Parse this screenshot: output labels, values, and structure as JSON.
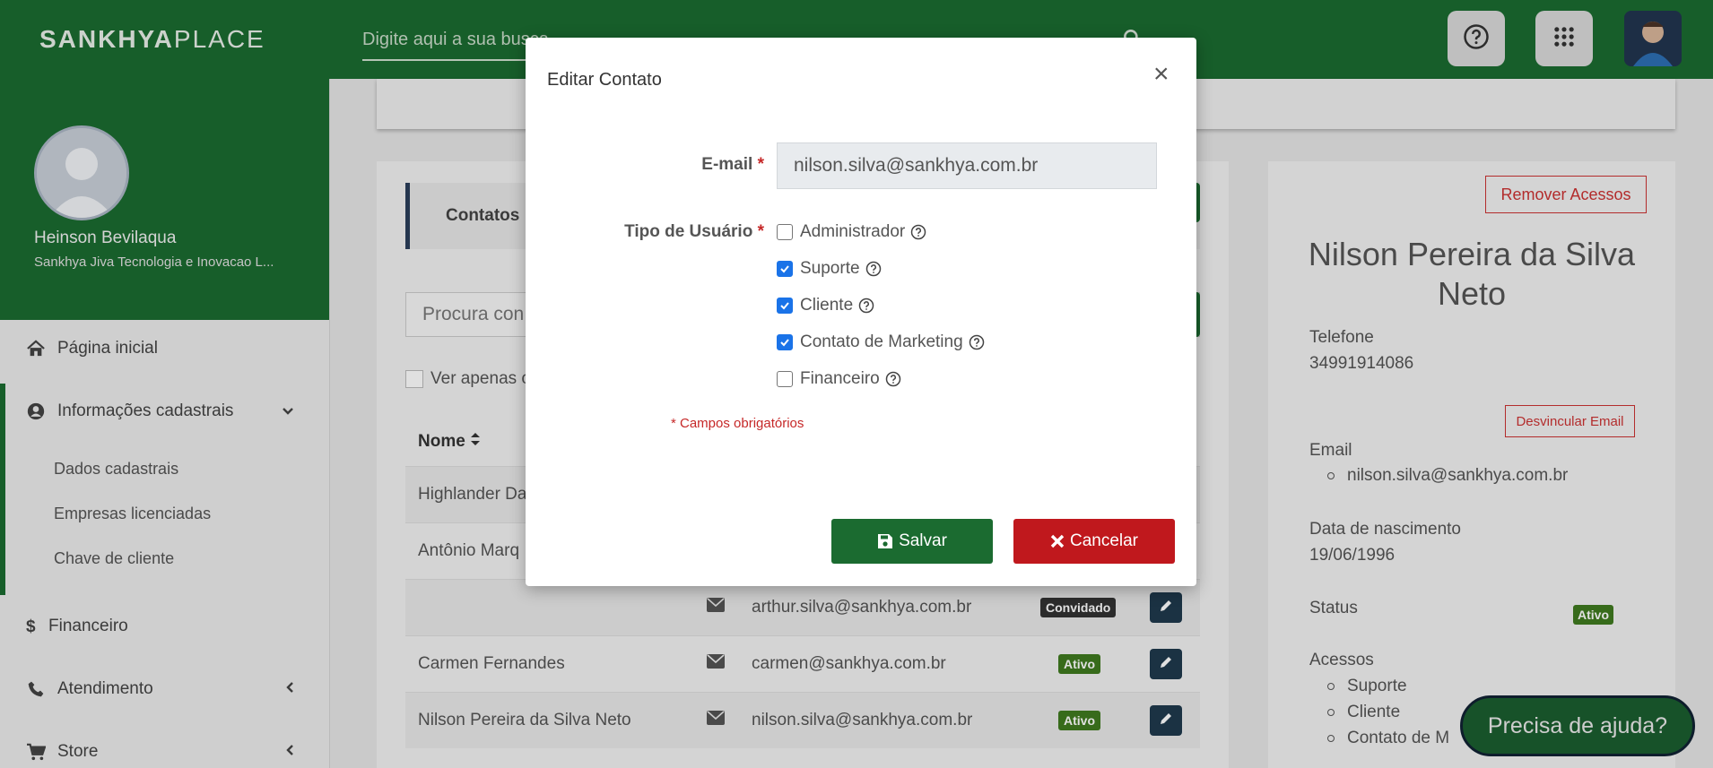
{
  "header": {
    "logo_bold": "SANKHYA",
    "logo_light": "PLACE",
    "search_placeholder": "Digite aqui a sua busca",
    "help_icon": "question-circle-icon",
    "apps_icon": "grid-dots-icon"
  },
  "sidebar": {
    "user_name": "Heinson Bevilaqua",
    "user_company": "Sankhya Jiva Tecnologia e Inovacao L...",
    "items": [
      {
        "label": "Página inicial",
        "icon": "home-icon"
      },
      {
        "label": "Informações cadastrais",
        "icon": "user-circle-icon"
      },
      {
        "label": "Financeiro",
        "icon": "dollar-icon"
      },
      {
        "label": "Atendimento",
        "icon": "phone-icon"
      },
      {
        "label": "Store",
        "icon": "cart-icon"
      }
    ],
    "subitems": [
      "Dados cadastrais",
      "Empresas licenciadas",
      "Chave de cliente"
    ]
  },
  "contacts": {
    "tab_label": "Contatos",
    "search_placeholder": "Procura con",
    "filter_label": "Ver apenas c",
    "column_name": "Nome",
    "rows": [
      {
        "name": "Highlander Da",
        "email": "",
        "status": ""
      },
      {
        "name": "Antônio Marq",
        "email": "",
        "status": ""
      },
      {
        "name": "",
        "email": "arthur.silva@sankhya.com.br",
        "status": "Convidado"
      },
      {
        "name": "Carmen Fernandes",
        "email": "carmen@sankhya.com.br",
        "status": "Ativo"
      },
      {
        "name": "Nilson Pereira da Silva Neto",
        "email": "nilson.silva@sankhya.com.br",
        "status": "Ativo"
      }
    ]
  },
  "detail": {
    "remove_button": "Remover Acessos",
    "name": "Nilson Pereira da Silva Neto",
    "phone_label": "Telefone",
    "phone": "34991914086",
    "unlink_button": "Desvincular Email",
    "email_label": "Email",
    "email": "nilson.silva@sankhya.com.br",
    "birth_label": "Data de nascimento",
    "birth": "19/06/1996",
    "status_label": "Status",
    "status": "Ativo",
    "access_label": "Acessos",
    "access_items": [
      "Suporte",
      "Cliente",
      "Contato de M"
    ]
  },
  "help_pill": "Precisa de ajuda?",
  "modal": {
    "title": "Editar Contato",
    "close": "×",
    "email_label": "E-mail",
    "email_value": "nilson.silva@sankhya.com.br",
    "type_label": "Tipo de Usuário",
    "required_mark": "*",
    "options": [
      {
        "label": "Administrador",
        "checked": false
      },
      {
        "label": "Suporte",
        "checked": true
      },
      {
        "label": "Cliente",
        "checked": true
      },
      {
        "label": "Contato de Marketing",
        "checked": true
      },
      {
        "label": "Financeiro",
        "checked": false
      }
    ],
    "required_note": "* Campos obrigatórios",
    "save_label": "Salvar",
    "cancel_label": "Cancelar"
  },
  "colors": {
    "brand_green": "#1b6b30",
    "danger_red": "#c0181d",
    "badge_green": "#3f7a1f"
  }
}
